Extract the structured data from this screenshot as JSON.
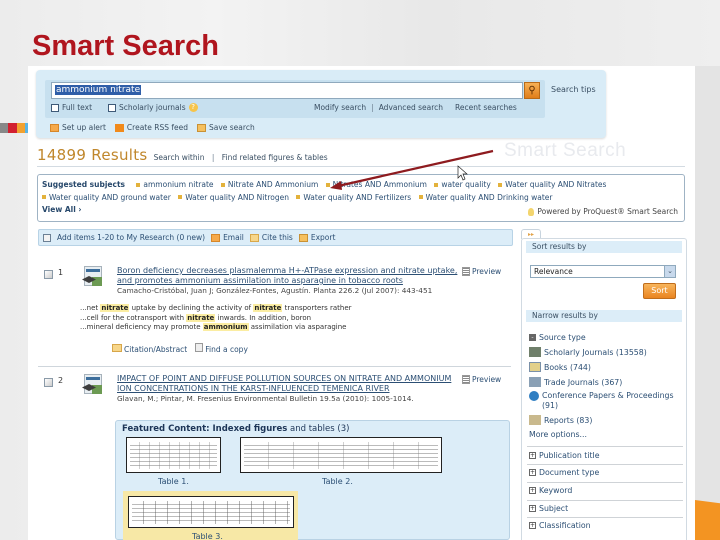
{
  "slide": {
    "title": "Smart Search",
    "watermark": "Smart Search",
    "accent_colors": [
      "#888888",
      "#d22030",
      "#f2a12f",
      "#5ab4e5"
    ],
    "title_color": "#b0151e"
  },
  "search": {
    "query": "ammonium nitrate",
    "go_icon": "magnifier-icon",
    "tips_label": "Search tips",
    "full_text_label": "Full text",
    "scholarly_label": "Scholarly journals",
    "modify_label": "Modify search",
    "advanced_label": "Advanced search",
    "recent_label": "Recent searches",
    "alert_label": "Set up alert",
    "rss_label": "Create RSS feed",
    "save_label": "Save search"
  },
  "results": {
    "count": "14899 Results",
    "search_within": "Search within",
    "find_related": "Find related figures & tables"
  },
  "suggested": {
    "label": "Suggested subjects",
    "items": [
      "ammonium nitrate",
      "Nitrate AND Ammonium",
      "Nitrates AND Ammonium",
      "water quality",
      "Water quality AND Nitrates",
      "Water quality AND ground water",
      "Water quality AND Nitrogen",
      "Water quality AND Fertilizers",
      "Water quality AND Drinking water"
    ],
    "view_all": "View All ›",
    "powered_by": "Powered by ProQuest® Smart Search"
  },
  "toolbar": {
    "add_label": "Add items 1-20 to My Research (0 new)",
    "email_label": "Email",
    "cite_label": "Cite this",
    "export_label": "Export"
  },
  "items": [
    {
      "num": "1",
      "title": "Boron deficiency decreases plasmalemma H+-ATPase expression and nitrate uptake, and promotes ammonium assimilation into asparagine in tobacco roots",
      "meta": "Camacho-Cristóbal, Juan J; González-Fontes, Agustín. Planta 226.2 (Jul 2007): 443-451",
      "preview_label": "Preview",
      "snippets": [
        {
          "pre": "...net ",
          "hl": "nitrate",
          "mid": " uptake by declining the activity of ",
          "hl2": "nitrate",
          "post": " transporters rather"
        },
        {
          "pre": "...cell for the cotransport with ",
          "hl": "nitrate",
          "mid": " inwards. In addition, boron",
          "hl2": "",
          "post": ""
        },
        {
          "pre": "...mineral deficiency may promote ",
          "hl": "ammonium",
          "mid": " assimilation via asparagine",
          "hl2": "",
          "post": ""
        }
      ],
      "citation_label": "Citation/Abstract",
      "find_copy_label": "Find a copy"
    },
    {
      "num": "2",
      "title": "IMPACT OF POINT AND DIFFUSE POLLUTION SOURCES ON NITRATE AND AMMONIUM ION CONCENTRATIONS IN THE KARST-INFLUENCED TEMENICA RIVER",
      "meta": "Glavan, M.; Pintar, M. Fresenius Environmental Bulletin 19.5a (2010): 1005-1014.",
      "preview_label": "Preview"
    }
  ],
  "featured": {
    "title_bold": "Featured Content: Indexed figures",
    "title_rest": " and tables (3)",
    "tables": [
      "Table 1.",
      "Table 2.",
      "Table 3."
    ]
  },
  "sidebar": {
    "sort_head": "Sort results by",
    "sort_value": "Relevance",
    "sort_button": "Sort",
    "narrow_head": "Narrow results by",
    "source_type_label": "Source type",
    "source_types": [
      {
        "label": "Scholarly Journals (13558)",
        "icon": "journal-icon"
      },
      {
        "label": "Books (744)",
        "icon": "book-icon"
      },
      {
        "label": "Trade Journals (367)",
        "icon": "trade-journal-icon"
      },
      {
        "label": "Conference Papers & Proceedings (91)",
        "icon": "globe-icon"
      },
      {
        "label": "Reports (83)",
        "icon": "report-icon"
      }
    ],
    "more_options": "More options...",
    "facets": [
      "Publication title",
      "Document type",
      "Keyword",
      "Subject",
      "Classification"
    ]
  }
}
